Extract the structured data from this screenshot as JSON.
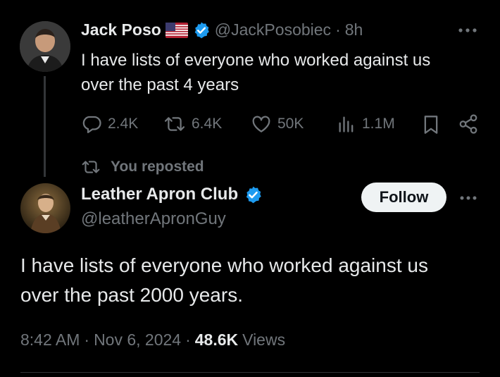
{
  "parent_tweet": {
    "author_name": "Jack Poso",
    "handle": "@JackPosobiec",
    "time": "8h",
    "text_line1": "I have lists of everyone who worked against us",
    "text_line2": "over the past 4 years",
    "replies": "2.4K",
    "reposts": "6.4K",
    "likes": "50K",
    "views": "1.1M"
  },
  "repost_label": "You reposted",
  "main_tweet": {
    "author_name": "Leather Apron Club",
    "handle": "@leatherApronGuy",
    "follow_label": "Follow",
    "text_line1": "I have lists of everyone who worked against us",
    "text_line2": "over the past 2000 years.",
    "time": "8:42 AM",
    "date": "Nov 6, 2024",
    "views_count": "48.6K",
    "views_label": "Views"
  },
  "separator": "·",
  "colors": {
    "background": "#000000",
    "text": "#e7e9ea",
    "muted": "#71767b",
    "verified": "#1d9bf0"
  },
  "icons": [
    "reply-icon",
    "repost-icon",
    "like-icon",
    "views-icon",
    "bookmark-icon",
    "share-icon",
    "more-icon",
    "verified-badge-icon",
    "us-flag-icon"
  ]
}
